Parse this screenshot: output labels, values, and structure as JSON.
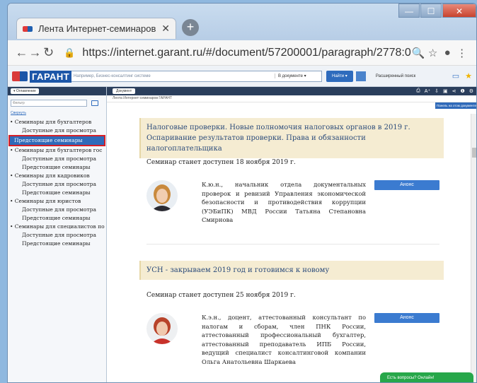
{
  "browser": {
    "tab_title": "Лента Интернет-семинаров ГАР",
    "tab_close": "✕",
    "new_tab": "+",
    "window_controls": {
      "minimize": "—",
      "maximize": "☐",
      "close": "✕"
    },
    "url": "https://internet.garant.ru/#/document/57200001/paragraph/2778:0"
  },
  "garant_header": {
    "logo_text": "ГАРАНТ",
    "search_placeholder": "Например, Бизнес-консалтинг системе",
    "search_scope": "В документе ▾",
    "find_button": "Найти ▾",
    "extended_search": "Расширенный поиск"
  },
  "left_panel": {
    "tab_label": "▾ Оглавление",
    "search_placeholder": "Фильтр",
    "collapse_link": "Свернуть",
    "tree": [
      {
        "label": "• Семинары для бухгалтеров",
        "level": 0,
        "selected": false
      },
      {
        "label": "Доступные для просмотра",
        "level": 1,
        "selected": false
      },
      {
        "label": "Предстоящие семинары",
        "level": 1,
        "selected": true
      },
      {
        "label": "• Семинары для бухгалтеров гос",
        "level": 0,
        "selected": false
      },
      {
        "label": "Доступные для просмотра",
        "level": 1,
        "selected": false
      },
      {
        "label": "Предстоящие семинары",
        "level": 1,
        "selected": false
      },
      {
        "label": "• Семинары для кадровиков",
        "level": 0,
        "selected": false
      },
      {
        "label": "Доступные для просмотра",
        "level": 1,
        "selected": false
      },
      {
        "label": "Предстоящие семинары",
        "level": 1,
        "selected": false
      },
      {
        "label": "• Семинары для юристов",
        "level": 0,
        "selected": false
      },
      {
        "label": "Доступные для просмотра",
        "level": 1,
        "selected": false
      },
      {
        "label": "Предстоящие семинары",
        "level": 1,
        "selected": false
      },
      {
        "label": "• Семинары для специалистов по",
        "level": 0,
        "selected": false
      },
      {
        "label": "Доступные для просмотра",
        "level": 1,
        "selected": false
      },
      {
        "label": "Предстоящие семинары",
        "level": 1,
        "selected": false
      }
    ]
  },
  "main": {
    "doc_tab": "Документ",
    "breadcrumb": "Лента Интернет-семинаров ГАРАНТ",
    "side_panel_label": "Панель на этом документе",
    "seminars": [
      {
        "topic": "Налоговые проверки. Новые полномочия налоговых органов в 2019 г. Оспаривание результатов проверки. Права и обязанности налогоплательщика",
        "availability": "Семинар станет доступен 18 ноября 2019 г.",
        "speaker": "К.ю.н., начальник отдела документальных проверок и ревизий Управления экономической безопасности и противодействия коррупции (УЭБиПК) МВД России Татьяна Степановна Смирнова",
        "button": "Анонс"
      },
      {
        "topic": "УСН - закрываем 2019 год и готовимся к новому",
        "availability": "Семинар станет доступен 25 ноября 2019 г.",
        "speaker": "К.э.н., доцент, аттестованный консультант по налогам и сборам, член ПНК России, аттестованный профессиональный бухгалтер, аттестованный преподаватель ИПБ России, ведущий специалист консалтинговой компании Ольга Анатольевна Шаркаева",
        "button": "Анонс"
      }
    ],
    "chat_label": "Есть вопросы? Онлайн!"
  },
  "colors": {
    "accent": "#2f6ab9",
    "topic_bg": "#f5ecd2",
    "selected_border": "#d61f26",
    "chat": "#27a74a"
  }
}
